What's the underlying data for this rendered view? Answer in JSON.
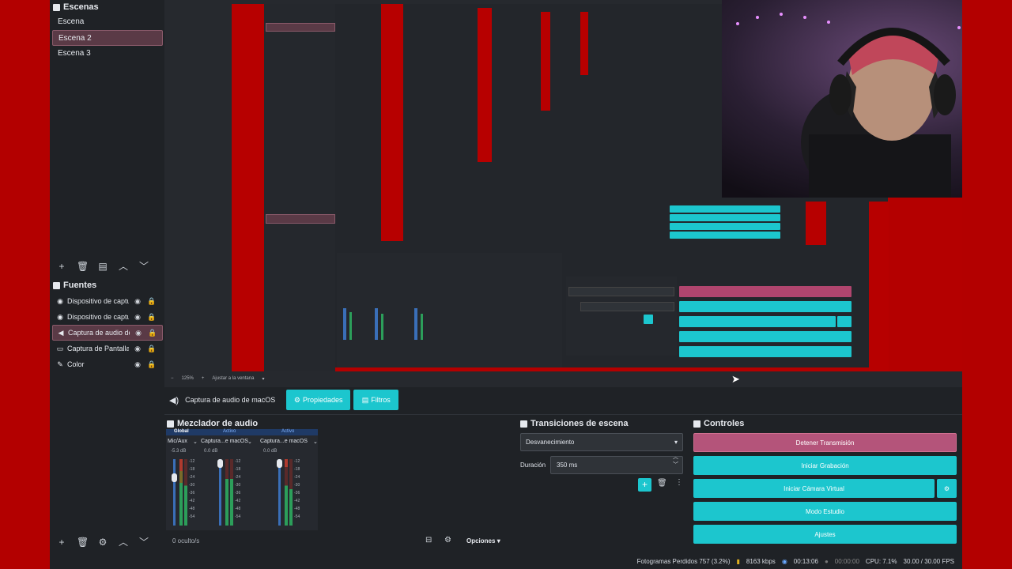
{
  "scenes": {
    "title": "Escenas",
    "items": [
      {
        "label": "Escena"
      },
      {
        "label": "Escena 2"
      },
      {
        "label": "Escena 3"
      }
    ]
  },
  "sources": {
    "title": "Fuentes",
    "items": [
      {
        "label": "Dispositivo de captu",
        "icon": "camera-icon"
      },
      {
        "label": "Dispositivo de captu",
        "icon": "camera-icon"
      },
      {
        "label": "Captura de audio de",
        "icon": "speaker-icon"
      },
      {
        "label": "Captura de Pantalla",
        "icon": "monitor-icon"
      },
      {
        "label": "Color",
        "icon": "brush-icon"
      }
    ]
  },
  "zoom": {
    "level": "125%",
    "fit_label": "Ajustar a la ventana"
  },
  "source_toolbar": {
    "source_name": "Captura de audio de macOS",
    "properties_label": "Propiedades",
    "filters_label": "Filtros"
  },
  "mixer": {
    "title": "Mezclador de audio",
    "tab_global": "Global",
    "tab_active_1": "Activo",
    "tab_active_2": "Activo",
    "channels": [
      {
        "name": "Mic/Aux",
        "db": "-5.3 dB"
      },
      {
        "name": "Captura...e macOS",
        "db": "0.0 dB"
      },
      {
        "name": "Captura...e macOS",
        "db": "0.0 dB"
      }
    ],
    "scale": [
      "-12",
      "-18",
      "-24",
      "-30",
      "-36",
      "-42",
      "-48",
      "-54"
    ],
    "hidden_count": "0 oculto/s",
    "options_label": "Opciones"
  },
  "transitions": {
    "title": "Transiciones de escena",
    "selected": "Desvanecimiento",
    "duration_label": "Duración",
    "duration_value": "350 ms"
  },
  "controls": {
    "title": "Controles",
    "stop_stream": "Detener Transmisión",
    "start_recording": "Iniciar Grabación",
    "start_virtual_cam": "Iniciar Cámara Virtual",
    "studio_mode": "Modo Estudio",
    "settings": "Ajustes"
  },
  "status": {
    "dropped_frames": "Fotogramas Perdidos 757 (3.2%)",
    "bitrate": "8163 kbps",
    "stream_time": "00:13:06",
    "rec_time": "00:00:00",
    "cpu": "CPU: 7.1%",
    "fps": "30.00 / 30.00 FPS"
  },
  "colors": {
    "accent": "#1cc6ce",
    "stop": "#b4547a",
    "background": "#1f2226",
    "frame": "#b30000"
  }
}
